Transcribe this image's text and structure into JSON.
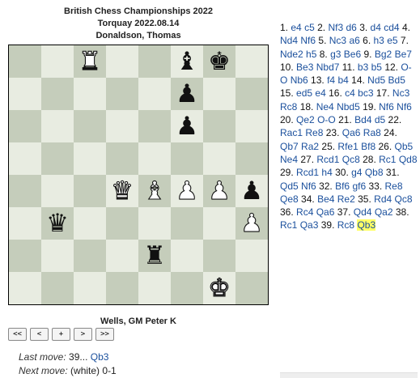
{
  "header": {
    "event": "British Chess Championships 2022",
    "site_date": "Torquay 2022.08.14",
    "player_top": "Donaldson, Thomas"
  },
  "player_bottom": "Wells, GM Peter K",
  "board": {
    "light_color": "#e8ece1",
    "dark_color": "#c5cdbb",
    "pieces": [
      {
        "file": "c",
        "rank": 8,
        "color": "w",
        "glyph": "♜",
        "name": "white-rook"
      },
      {
        "file": "f",
        "rank": 8,
        "color": "b",
        "glyph": "♝",
        "name": "black-bishop"
      },
      {
        "file": "g",
        "rank": 8,
        "color": "b",
        "glyph": "♚",
        "name": "black-king"
      },
      {
        "file": "f",
        "rank": 7,
        "color": "b",
        "glyph": "♟",
        "name": "black-pawn"
      },
      {
        "file": "f",
        "rank": 6,
        "color": "b",
        "glyph": "♟",
        "name": "black-pawn"
      },
      {
        "file": "d",
        "rank": 4,
        "color": "w",
        "glyph": "♛",
        "name": "white-queen"
      },
      {
        "file": "e",
        "rank": 4,
        "color": "w",
        "glyph": "♝",
        "name": "white-bishop"
      },
      {
        "file": "f",
        "rank": 4,
        "color": "w",
        "glyph": "♟",
        "name": "white-pawn"
      },
      {
        "file": "g",
        "rank": 4,
        "color": "w",
        "glyph": "♟",
        "name": "white-pawn"
      },
      {
        "file": "h",
        "rank": 4,
        "color": "b",
        "glyph": "♟",
        "name": "black-pawn"
      },
      {
        "file": "b",
        "rank": 3,
        "color": "b",
        "glyph": "♛",
        "name": "black-queen"
      },
      {
        "file": "h",
        "rank": 3,
        "color": "w",
        "glyph": "♟",
        "name": "white-pawn"
      },
      {
        "file": "e",
        "rank": 2,
        "color": "b",
        "glyph": "♜",
        "name": "black-rook"
      },
      {
        "file": "g",
        "rank": 1,
        "color": "w",
        "glyph": "♚",
        "name": "white-king"
      }
    ]
  },
  "controls": {
    "first": "<<",
    "prev": "<",
    "flip": "+",
    "next": ">",
    "last": ">>"
  },
  "status": {
    "last_move_label": "Last move:",
    "last_move_num": "39...",
    "last_move_san": "Qb3",
    "next_move_label": "Next move:",
    "next_move_side": "(white)",
    "result": "0-1"
  },
  "moves": [
    {
      "n": "1.",
      "w": "e4",
      "b": "c5"
    },
    {
      "n": "2.",
      "w": "Nf3",
      "b": "d6"
    },
    {
      "n": "3.",
      "w": "d4",
      "b": "cd4"
    },
    {
      "n": "4.",
      "w": "Nd4",
      "b": "Nf6"
    },
    {
      "n": "5.",
      "w": "Nc3",
      "b": "a6"
    },
    {
      "n": "6.",
      "w": "h3",
      "b": "e5"
    },
    {
      "n": "7.",
      "w": "Nde2",
      "b": "h5"
    },
    {
      "n": "8.",
      "w": "g3",
      "b": "Be6"
    },
    {
      "n": "9.",
      "w": "Bg2",
      "b": "Be7"
    },
    {
      "n": "10.",
      "w": "Be3",
      "b": "Nbd7"
    },
    {
      "n": "11.",
      "w": "b3",
      "b": "b5"
    },
    {
      "n": "12.",
      "w": "O-O",
      "b": "Nb6"
    },
    {
      "n": "13.",
      "w": "f4",
      "b": "b4"
    },
    {
      "n": "14.",
      "w": "Nd5",
      "b": "Bd5"
    },
    {
      "n": "15.",
      "w": "ed5",
      "b": "e4"
    },
    {
      "n": "16.",
      "w": "c4",
      "b": "bc3"
    },
    {
      "n": "17.",
      "w": "Nc3",
      "b": "Rc8"
    },
    {
      "n": "18.",
      "w": "Ne4",
      "b": "Nbd5"
    },
    {
      "n": "19.",
      "w": "Nf6",
      "b": "Nf6"
    },
    {
      "n": "20.",
      "w": "Qe2",
      "b": "O-O"
    },
    {
      "n": "21.",
      "w": "Bd4",
      "b": "d5"
    },
    {
      "n": "22.",
      "w": "Rac1",
      "b": "Re8"
    },
    {
      "n": "23.",
      "w": "Qa6",
      "b": "Ra8"
    },
    {
      "n": "24.",
      "w": "Qb7",
      "b": "Ra2"
    },
    {
      "n": "25.",
      "w": "Rfe1",
      "b": "Bf8"
    },
    {
      "n": "26.",
      "w": "Qb5",
      "b": "Ne4"
    },
    {
      "n": "27.",
      "w": "Rcd1",
      "b": "Qc8"
    },
    {
      "n": "28.",
      "w": "Rc1",
      "b": "Qd8"
    },
    {
      "n": "29.",
      "w": "Rcd1",
      "b": "h4"
    },
    {
      "n": "30.",
      "w": "g4",
      "b": "Qb8"
    },
    {
      "n": "31.",
      "w": "Qd5",
      "b": "Nf6"
    },
    {
      "n": "32.",
      "w": "Bf6",
      "b": "gf6"
    },
    {
      "n": "33.",
      "w": "Re8",
      "b": "Qe8"
    },
    {
      "n": "34.",
      "w": "Be4",
      "b": "Re2"
    },
    {
      "n": "35.",
      "w": "Rd4",
      "b": "Qc8"
    },
    {
      "n": "36.",
      "w": "Rc4",
      "b": "Qa6"
    },
    {
      "n": "37.",
      "w": "Qd4",
      "b": "Qa2"
    },
    {
      "n": "38.",
      "w": "Rc1",
      "b": "Qa3"
    },
    {
      "n": "39.",
      "w": "Rc8",
      "b": "Qb3"
    }
  ],
  "current_move": "39b",
  "highlight_color": "#ffff66",
  "link_color": "#1a4f9c"
}
